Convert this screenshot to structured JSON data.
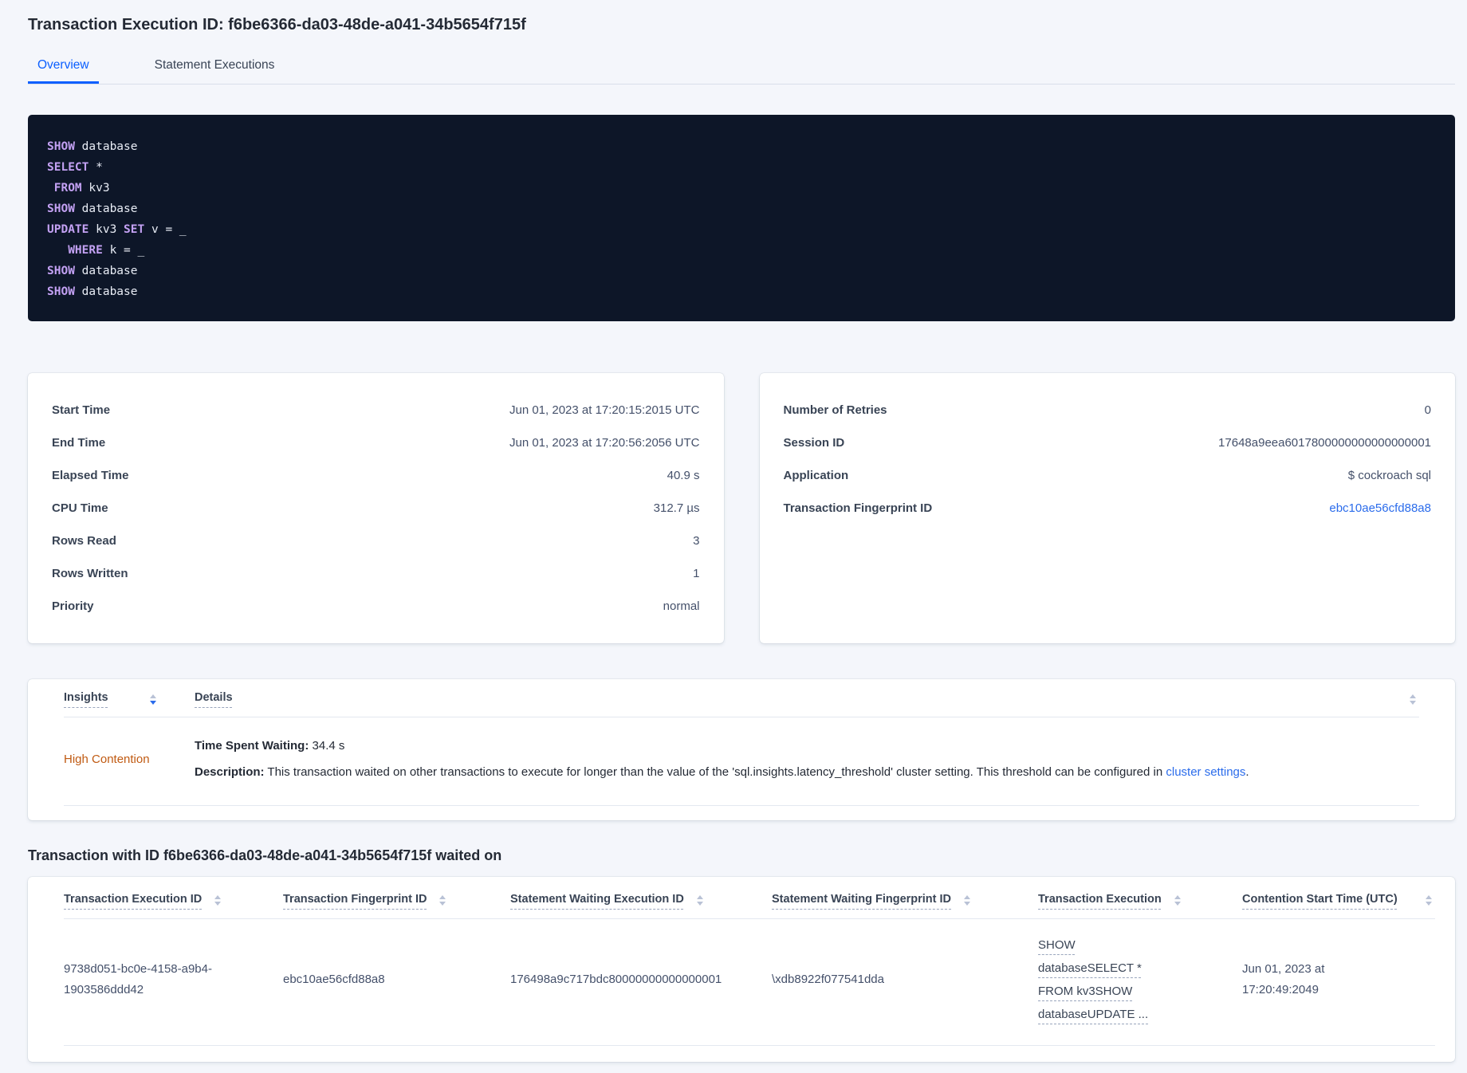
{
  "page": {
    "title": "Transaction Execution ID: f6be6366-da03-48de-a041-34b5654f715f"
  },
  "tabs": [
    {
      "label": "Overview",
      "active": true
    },
    {
      "label": "Statement Executions",
      "active": false
    }
  ],
  "sql_box": {
    "lines": [
      [
        {
          "t": "SHOW",
          "kw": true
        },
        {
          "t": " database"
        }
      ],
      [
        {
          "t": "SELECT",
          "kw": true
        },
        {
          "t": " *"
        }
      ],
      [
        {
          "t": " "
        },
        {
          "t": "FROM",
          "kw": true
        },
        {
          "t": " kv3"
        }
      ],
      [
        {
          "t": "SHOW",
          "kw": true
        },
        {
          "t": " database"
        }
      ],
      [
        {
          "t": "UPDATE",
          "kw": true
        },
        {
          "t": " kv3 "
        },
        {
          "t": "SET",
          "kw": true
        },
        {
          "t": " v = _"
        }
      ],
      [
        {
          "t": "   "
        },
        {
          "t": "WHERE",
          "kw": true
        },
        {
          "t": " k = _"
        }
      ],
      [
        {
          "t": "SHOW",
          "kw": true
        },
        {
          "t": " database"
        }
      ],
      [
        {
          "t": "SHOW",
          "kw": true
        },
        {
          "t": " database"
        }
      ]
    ]
  },
  "summary_left": {
    "rows": [
      {
        "label": "Start Time",
        "value": "Jun 01, 2023 at 17:20:15:2015 UTC"
      },
      {
        "label": "End Time",
        "value": "Jun 01, 2023 at 17:20:56:2056 UTC"
      },
      {
        "label": "Elapsed Time",
        "value": "40.9 s"
      },
      {
        "label": "CPU Time",
        "value": "312.7 µs"
      },
      {
        "label": "Rows Read",
        "value": "3"
      },
      {
        "label": "Rows Written",
        "value": "1"
      },
      {
        "label": "Priority",
        "value": "normal"
      }
    ]
  },
  "summary_right": {
    "rows": [
      {
        "label": "Number of Retries",
        "value": "0"
      },
      {
        "label": "Session ID",
        "value": "17648a9eea6017800000000000000001"
      },
      {
        "label": "Application",
        "value": "$ cockroach sql"
      }
    ],
    "fingerprint_label": "Transaction Fingerprint ID",
    "fingerprint_value": "ebc10ae56cfd88a8"
  },
  "insights": {
    "col_insights": "Insights",
    "col_details": "Details",
    "row": {
      "insight": "High Contention",
      "waiting_label": "Time Spent Waiting:",
      "waiting_value": " 34.4 s",
      "description_label": "Description:",
      "description_text": " This transaction waited on other transactions to execute for longer than the value of the 'sql.insights.latency_threshold' cluster setting. This threshold can be configured in ",
      "description_link": "cluster settings",
      "description_suffix": "."
    }
  },
  "waited_on": {
    "heading": "Transaction with ID f6be6366-da03-48de-a041-34b5654f715f waited on",
    "columns": [
      "Transaction Execution ID",
      "Transaction Fingerprint ID",
      "Statement Waiting Execution ID",
      "Statement Waiting Fingerprint ID",
      "Transaction Execution",
      "Contention Start Time (UTC)"
    ],
    "row": {
      "transaction_execution_id": "9738d051-bc0e-4158-a9b4-1903586ddd42",
      "transaction_fingerprint_id": "ebc10ae56cfd88a8",
      "statement_waiting_execution_id": "176498a9c717bdc80000000000000001",
      "statement_waiting_fingerprint_id": "\\xdb8922f077541dda",
      "transaction_execution": "SHOW databaseSELECT * FROM kv3SHOW databaseUPDATE ...",
      "contention_start_time": "Jun 01, 2023 at 17:20:49:2049"
    }
  },
  "colors": {
    "accent_blue": "#0b5fff",
    "link_blue": "#2b6ceb",
    "insight_orange": "#c05a12",
    "code_background": "#0d1628",
    "code_keyword": "#c3a1f3",
    "page_background": "#f4f6fb"
  }
}
